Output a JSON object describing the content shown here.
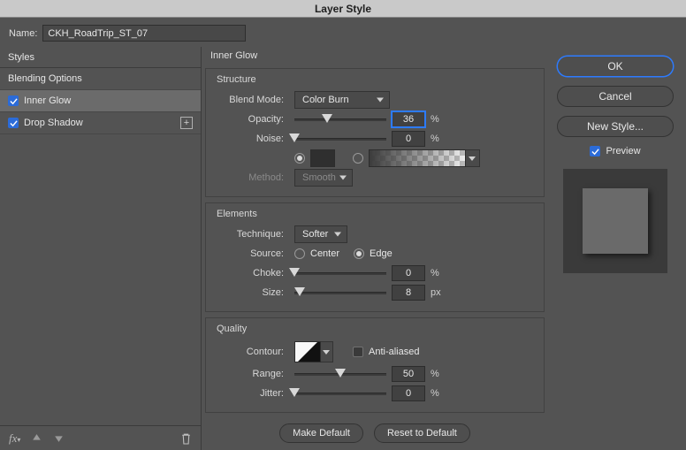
{
  "window": {
    "title": "Layer Style"
  },
  "name": {
    "label": "Name:",
    "value": "CKH_RoadTrip_ST_07"
  },
  "left": {
    "head": "Styles",
    "blending": "Blending Options",
    "inner_glow": "Inner Glow",
    "drop_shadow": "Drop Shadow"
  },
  "mid": {
    "title": "Inner Glow",
    "structure": {
      "title": "Structure",
      "blend_mode_label": "Blend Mode:",
      "blend_mode_value": "Color Burn",
      "opacity_label": "Opacity:",
      "opacity_value": "36",
      "opacity_unit": "%",
      "noise_label": "Noise:",
      "noise_value": "0",
      "noise_unit": "%",
      "method_label": "Method:",
      "method_value": "Smooth"
    },
    "elements": {
      "title": "Elements",
      "technique_label": "Technique:",
      "technique_value": "Softer",
      "source_label": "Source:",
      "center": "Center",
      "edge": "Edge",
      "choke_label": "Choke:",
      "choke_value": "0",
      "choke_unit": "%",
      "size_label": "Size:",
      "size_value": "8",
      "size_unit": "px"
    },
    "quality": {
      "title": "Quality",
      "contour_label": "Contour:",
      "antialias": "Anti-aliased",
      "range_label": "Range:",
      "range_value": "50",
      "range_unit": "%",
      "jitter_label": "Jitter:",
      "jitter_value": "0",
      "jitter_unit": "%"
    },
    "buttons": {
      "make_default": "Make Default",
      "reset_default": "Reset to Default"
    }
  },
  "right": {
    "ok": "OK",
    "cancel": "Cancel",
    "new_style": "New Style...",
    "preview": "Preview"
  },
  "icons": {
    "fx": "fx",
    "up": "up-icon",
    "down": "down-icon",
    "trash": "trash-icon",
    "plus": "+"
  },
  "colors": {
    "accent": "#2d7bff"
  }
}
